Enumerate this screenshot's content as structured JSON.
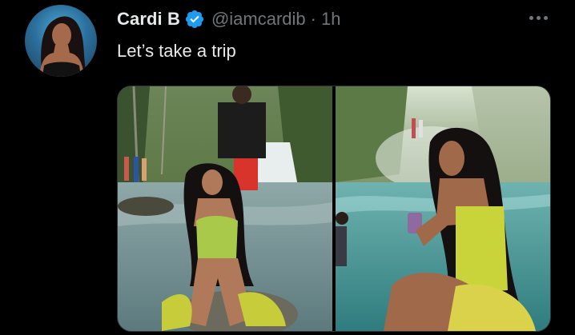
{
  "tweet": {
    "display_name": "Cardi B",
    "handle": "@iamcardib",
    "separator": "·",
    "time": "1h",
    "text": "Let’s take a trip",
    "verified": true
  },
  "icons": {
    "verified": "verified-badge-icon",
    "more": "more-options-icon"
  },
  "colors": {
    "background": "#000000",
    "primary_text": "#e7e9ea",
    "secondary_text": "#71767b",
    "verified_blue": "#1d9bf0",
    "media_border": "#2f3336"
  },
  "media": {
    "photos": [
      {
        "alt": "photo-1"
      },
      {
        "alt": "photo-2"
      }
    ]
  }
}
